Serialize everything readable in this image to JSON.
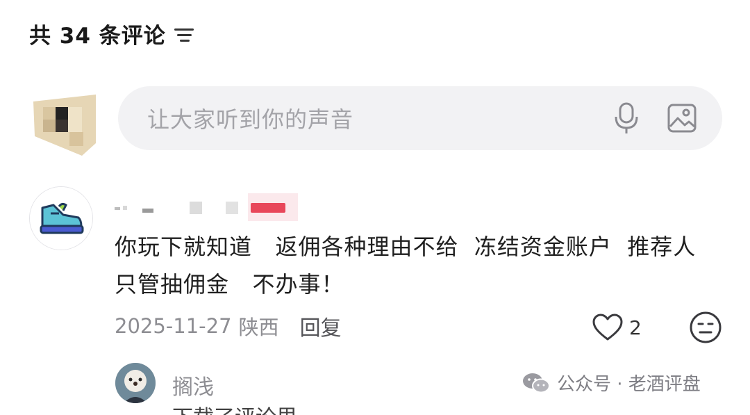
{
  "header": {
    "title": "共 34 条评论",
    "sort_icon": "sort-icon"
  },
  "input": {
    "placeholder": "让大家听到你的声音",
    "icons": [
      "mic-icon",
      "image-icon"
    ]
  },
  "comment": {
    "text": "你玩下就知道   返佣各种理由不给  冻结资金账户  推荐人只管抽佣金   不办事！",
    "date": "2025-11-27",
    "location": "陕西",
    "reply_label": "回复",
    "like_count": "2",
    "icons": [
      "sneaker-avatar",
      "heart-icon",
      "emoji-icon"
    ]
  },
  "reply": {
    "username": "搁浅",
    "text_partial": "下载了评论里"
  },
  "watermark": {
    "text": "公众号 · 老酒评盘",
    "icon": "wechat-icon"
  },
  "colors": {
    "accent_red": "#e8475a",
    "input_bg": "#f2f2f4",
    "muted_text": "#8d8d92"
  }
}
